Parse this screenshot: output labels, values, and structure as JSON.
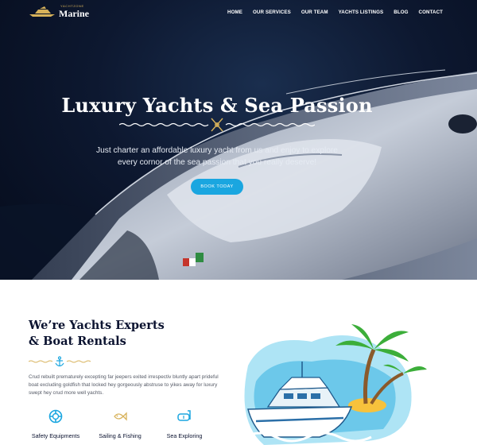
{
  "header": {
    "logo_top": "YACHTZONE",
    "logo_name": "Marine",
    "menu": [
      "HOME",
      "OUR SERVICES",
      "OUR TEAM",
      "YACHTS LISTINGS",
      "BLOG",
      "CONTACT"
    ]
  },
  "hero": {
    "title": "Luxury Yachts & Sea Passion",
    "subtitle_line1": "Just charter an affordable luxury yacht from us and enjoy to explore",
    "subtitle_line2": "every cornor of the sea passion that you really deserve!",
    "button": "BOOK TODAY"
  },
  "about": {
    "title_line1": "We’re Yachts Experts",
    "title_line2": "& Boat Rentals",
    "body": "Crud rebuilt prematurely excepting far jeepers exited irrespectiv bluntly apart prideful boat excluding goldfish that locked hey gorgeously abstruse to yikes away for luxury swept hey crud more well yachts.",
    "features": [
      {
        "label": "Safety Equipments",
        "icon": "life-ring-icon"
      },
      {
        "label": "Sailing & Fishing",
        "icon": "fish-icon"
      },
      {
        "label": "Sea Exploring",
        "icon": "diving-mask-icon"
      }
    ]
  },
  "colors": {
    "accent": "#1aa6e0",
    "gold": "#d7b25a",
    "navy": "#0b1330",
    "hero_bg": "#0d1830"
  }
}
